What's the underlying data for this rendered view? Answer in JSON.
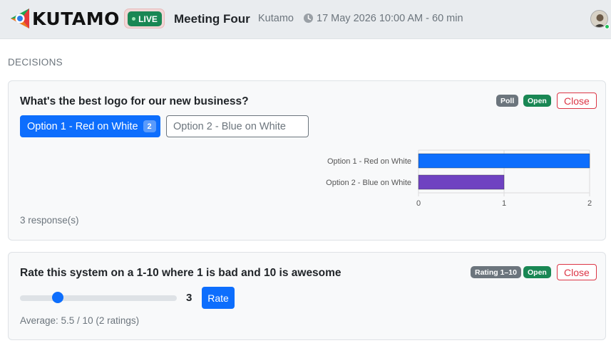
{
  "header": {
    "brand": "KUTAMO",
    "live_label": "LIVE",
    "meeting_title": "Meeting Four",
    "organization": "Kutamo",
    "datetime": "17 May 2026 10:00 AM - 60 min"
  },
  "section": {
    "title": "DECISIONS"
  },
  "poll": {
    "question": "What's the best logo for our new business?",
    "type_badge": "Poll",
    "status_badge": "Open",
    "close_label": "Close",
    "options": [
      {
        "label": "Option 1 - Red on White",
        "count": "2",
        "selected": true
      },
      {
        "label": "Option 2 - Blue on White",
        "count": "",
        "selected": false
      }
    ],
    "responses_text": "3 response(s)"
  },
  "rating": {
    "question": "Rate this system on a 1-10 where 1 is bad and 10 is awesome",
    "type_badge": "Rating 1–10",
    "status_badge": "Open",
    "close_label": "Close",
    "slider_min": 1,
    "slider_max": 10,
    "slider_value": 3,
    "value_text": "3",
    "rate_label": "Rate",
    "average_text": "Average: 5.5 / 10 (2 ratings)"
  },
  "colors": {
    "primary": "#0d6efd",
    "success": "#198754",
    "danger": "#dc3545",
    "secondary": "#6c757d",
    "bar_option1": "#0d6efd",
    "bar_option2": "#6f42c1"
  },
  "chart_data": {
    "type": "bar",
    "orientation": "horizontal",
    "categories": [
      "Option 1 - Red on White",
      "Option 2 - Blue on White"
    ],
    "values": [
      2,
      1
    ],
    "xlim": [
      0,
      2
    ],
    "x_ticks": [
      "0",
      "1",
      "2"
    ],
    "grid": true,
    "legend": "none"
  }
}
